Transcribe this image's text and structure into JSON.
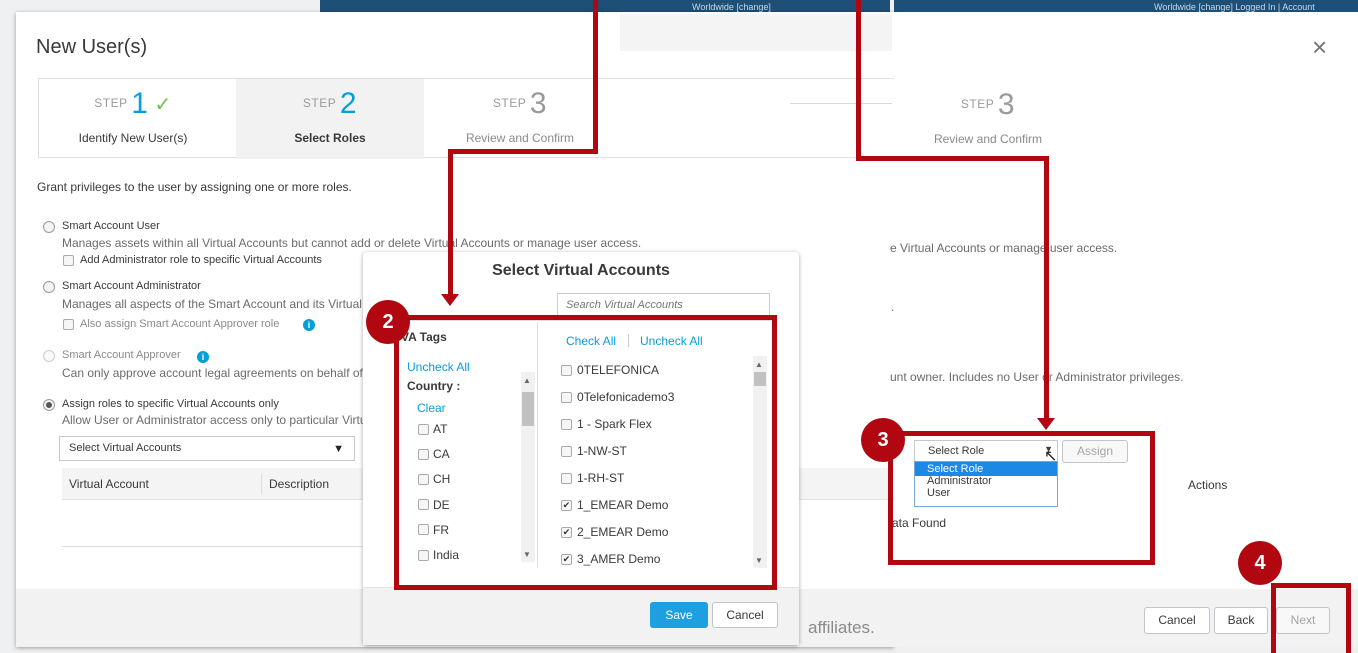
{
  "background": {
    "strip1": "Worldwide [change]",
    "strip2": "Worldwide [change]   Logged In | Account",
    "footer_text": "affiliates."
  },
  "main": {
    "title": "New User(s)",
    "steps": [
      {
        "prefix": "STEP",
        "number": "1",
        "label": "Identify New User(s)"
      },
      {
        "prefix": "STEP",
        "number": "2",
        "label": "Select Roles"
      },
      {
        "prefix": "STEP",
        "number": "3",
        "label": "Review and Confirm"
      }
    ],
    "intro": "Grant privileges to the user by assigning one or more roles.",
    "role1": {
      "label": "Smart Account User",
      "desc": "Manages assets within all Virtual Accounts but cannot add or delete Virtual Accounts or manage user access.",
      "option": "Add Administrator role to specific Virtual Accounts"
    },
    "role2": {
      "label": "Smart Account Administrator",
      "desc": "Manages all aspects of the Smart Account and its Virtual Accounts",
      "option": "Also assign Smart Account Approver role"
    },
    "role3": {
      "label": "Smart Account Approver",
      "desc": "Can only approve account legal agreements on behalf of the account owner."
    },
    "role4": {
      "label": "Assign roles to specific Virtual Accounts only",
      "desc": "Allow User or Administrator access only to particular Virtual Accounts"
    },
    "va_select": "Select Virtual Accounts",
    "col_va": "Virtual Account",
    "col_desc": "Description"
  },
  "right": {
    "step3_prefix": "STEP",
    "step3_number": "3",
    "step3_label": "Review and Confirm",
    "role1_tail": "e Virtual Accounts or manage user access.",
    "role2_tail": ".",
    "role3_tail": "unt owner. Includes no User or Administrator privileges.",
    "select_role": "Select Role",
    "assign": "Assign",
    "dropdown": [
      "Select Role",
      "Administrator",
      "User"
    ],
    "actions": "Actions",
    "no_data": "ata Found",
    "cancel": "Cancel",
    "back": "Back",
    "next": "Next",
    "close": "×"
  },
  "modal": {
    "title": "Select Virtual Accounts",
    "search_placeholder": "Search Virtual Accounts",
    "tags_heading": "VA Tags",
    "uncheck_all": "Uncheck All",
    "country_label": "Country :",
    "clear": "Clear",
    "countries": [
      "AT",
      "CA",
      "CH",
      "DE",
      "FR",
      "India"
    ],
    "check_all": "Check All",
    "uncheck_all_right": "Uncheck All",
    "accounts": [
      {
        "name": "0TELEFONICA",
        "checked": false
      },
      {
        "name": "0Telefonicademo3",
        "checked": false
      },
      {
        "name": "1 - Spark Flex",
        "checked": false
      },
      {
        "name": "1-NW-ST",
        "checked": false
      },
      {
        "name": "1-RH-ST",
        "checked": false
      },
      {
        "name": "1_EMEAR Demo",
        "checked": true
      },
      {
        "name": "2_EMEAR Demo",
        "checked": true
      },
      {
        "name": "3_AMER Demo",
        "checked": true
      }
    ],
    "save": "Save",
    "cancel": "Cancel"
  },
  "badges": [
    "2",
    "3",
    "4"
  ],
  "colors": {
    "accent": "#049fd9",
    "annotation": "#b00710",
    "primary_button": "#1e9fe0"
  }
}
